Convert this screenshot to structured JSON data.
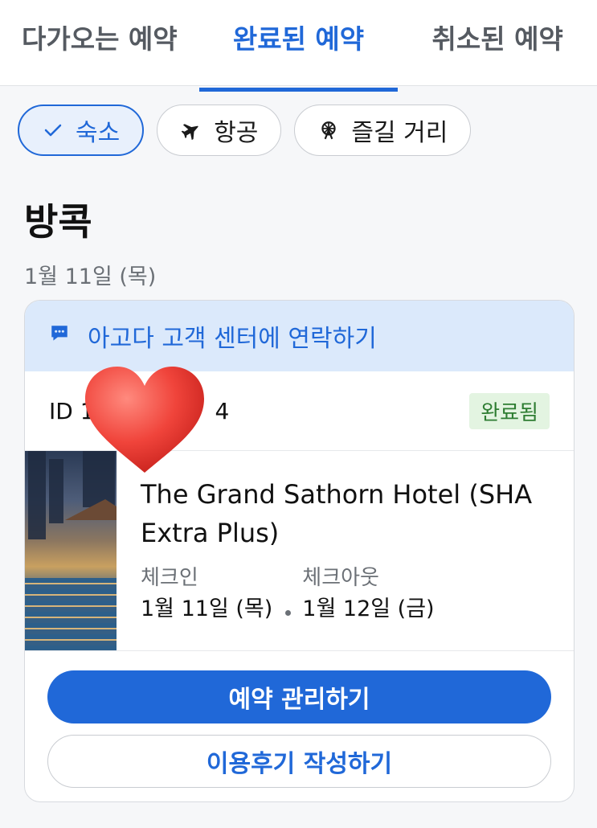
{
  "tabs": [
    {
      "label": "다가오는 예약",
      "active": false
    },
    {
      "label": "완료된 예약",
      "active": true
    },
    {
      "label": "취소된 예약",
      "active": false
    }
  ],
  "filters": [
    {
      "label": "숙소",
      "icon": "check-icon",
      "selected": true
    },
    {
      "label": "항공",
      "icon": "airplane-icon",
      "selected": false
    },
    {
      "label": "즐길 거리",
      "icon": "ferris-wheel-icon",
      "selected": false
    }
  ],
  "booking": {
    "city": "방콕",
    "date": "1월 11일 (목)",
    "contact_label": "아고다 고객 센터에 연락하기",
    "id_prefix": "ID 1",
    "id_suffix": "4",
    "status": "완료됨",
    "hotel_name": "The Grand Sathorn Hotel (SHA Extra Plus)",
    "checkin_label": "체크인",
    "checkin_date": "1월 11일 (목)",
    "checkout_label": "체크아웃",
    "checkout_date": "1월 12일 (금)",
    "manage_button": "예약 관리하기",
    "review_button": "이용후기 작성하기"
  },
  "colors": {
    "accent": "#2068d8",
    "contact_bg": "#dbe9fb",
    "status_bg": "#e3f4e1",
    "status_text": "#2e7d32",
    "heart": "#f0443b"
  }
}
